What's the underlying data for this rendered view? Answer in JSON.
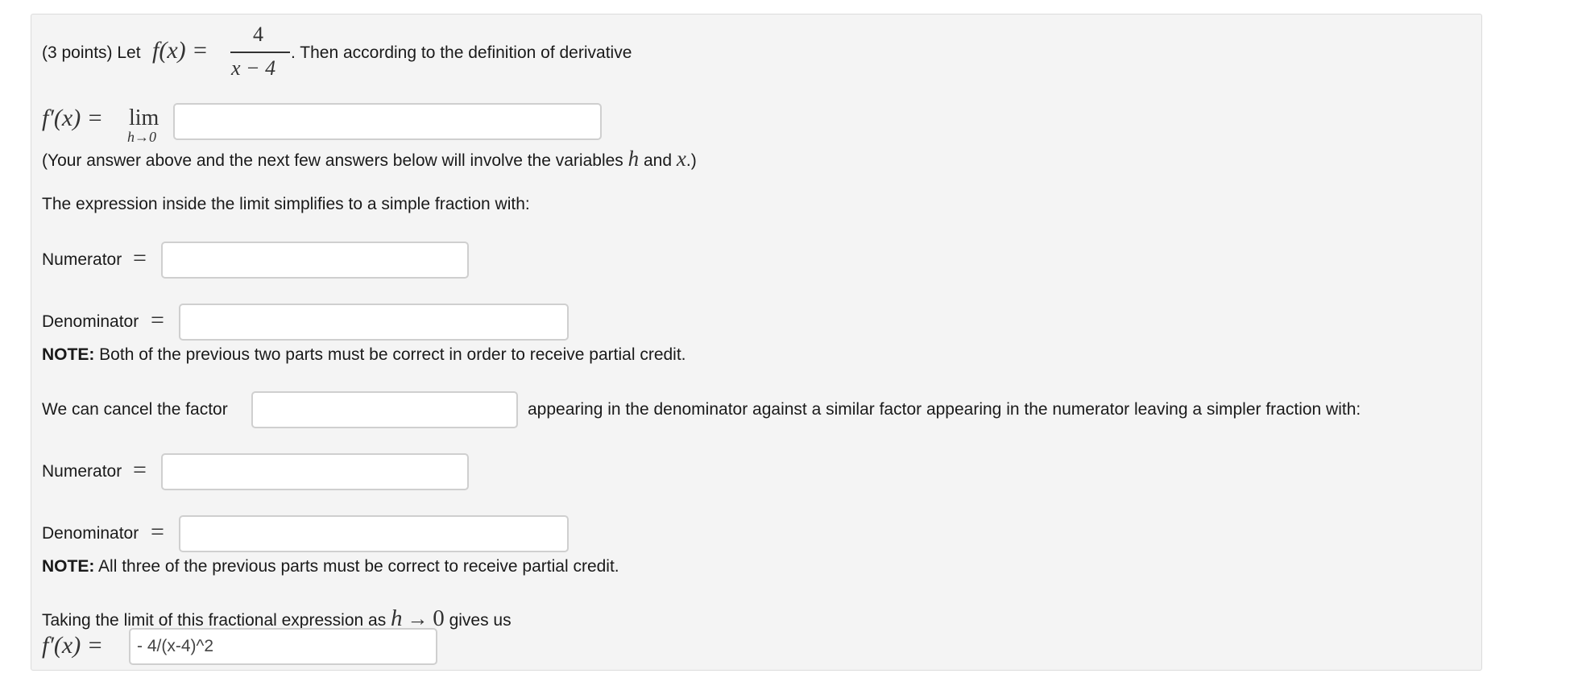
{
  "question": {
    "points_label": "(3 points) Let",
    "fx_lhs": "f(x) =",
    "fraction_numerator": "4",
    "fraction_denominator": "x − 4",
    "intro_suffix": ". Then according to the definition of derivative"
  },
  "derivative_limit": {
    "lhs": "f′(x) =",
    "lim": "lim",
    "lim_sub": "h→0",
    "input_value": "",
    "note_prefix": "(Your answer above and the next few answers below will involve the variables",
    "var_h": "h",
    "and": "and",
    "var_x": "x",
    "note_suffix": ".)"
  },
  "simplify": {
    "intro": "The expression inside the limit simplifies to a simple fraction with:",
    "numerator_label": "Numerator",
    "numerator_value": "",
    "denominator_label": "Denominator",
    "denominator_value": "",
    "equals": "=",
    "note_bold": "NOTE:",
    "note_text": "Both of the previous two parts must be correct in order to receive partial credit."
  },
  "cancel": {
    "prefix": "We can cancel the factor",
    "factor_value": "",
    "suffix": "appearing in the denominator against a similar factor appearing in the numerator leaving a simpler fraction with:",
    "numerator_label": "Numerator",
    "numerator_value": "",
    "denominator_label": "Denominator",
    "denominator_value": "",
    "equals": "=",
    "note_bold": "NOTE:",
    "note_text": "All three of the previous parts must be correct to receive partial credit."
  },
  "final": {
    "prefix": "Taking the limit of this fractional expression as",
    "h": "h",
    "arrow": "→",
    "zero": "0",
    "suffix": "gives us",
    "lhs": "f′(x) =",
    "answer_value": "- 4/(x-4)^2"
  }
}
